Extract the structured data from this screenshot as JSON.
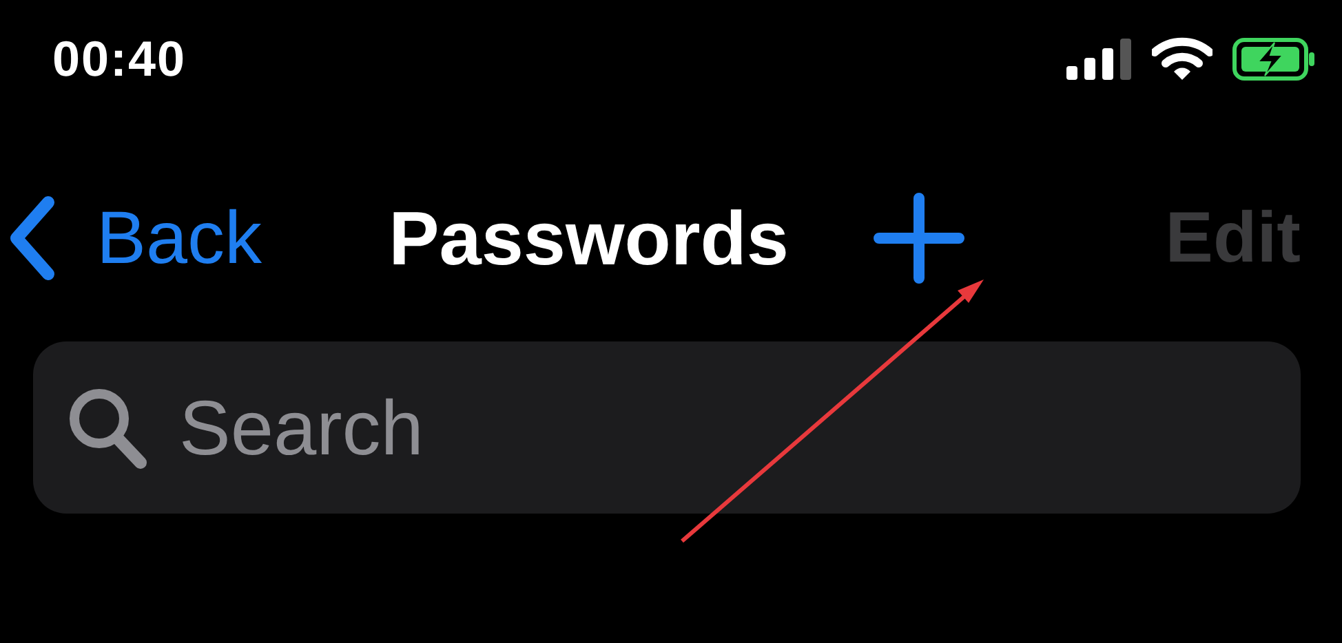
{
  "status_bar": {
    "time": "00:40",
    "battery_charging": true
  },
  "nav_bar": {
    "back_label": "Back",
    "title": "Passwords",
    "edit": {
      "label": "Edit",
      "disabled": true
    }
  },
  "search": {
    "placeholder": "Search"
  },
  "annotation": {
    "kind": "arrow",
    "color": "#e8393c"
  }
}
